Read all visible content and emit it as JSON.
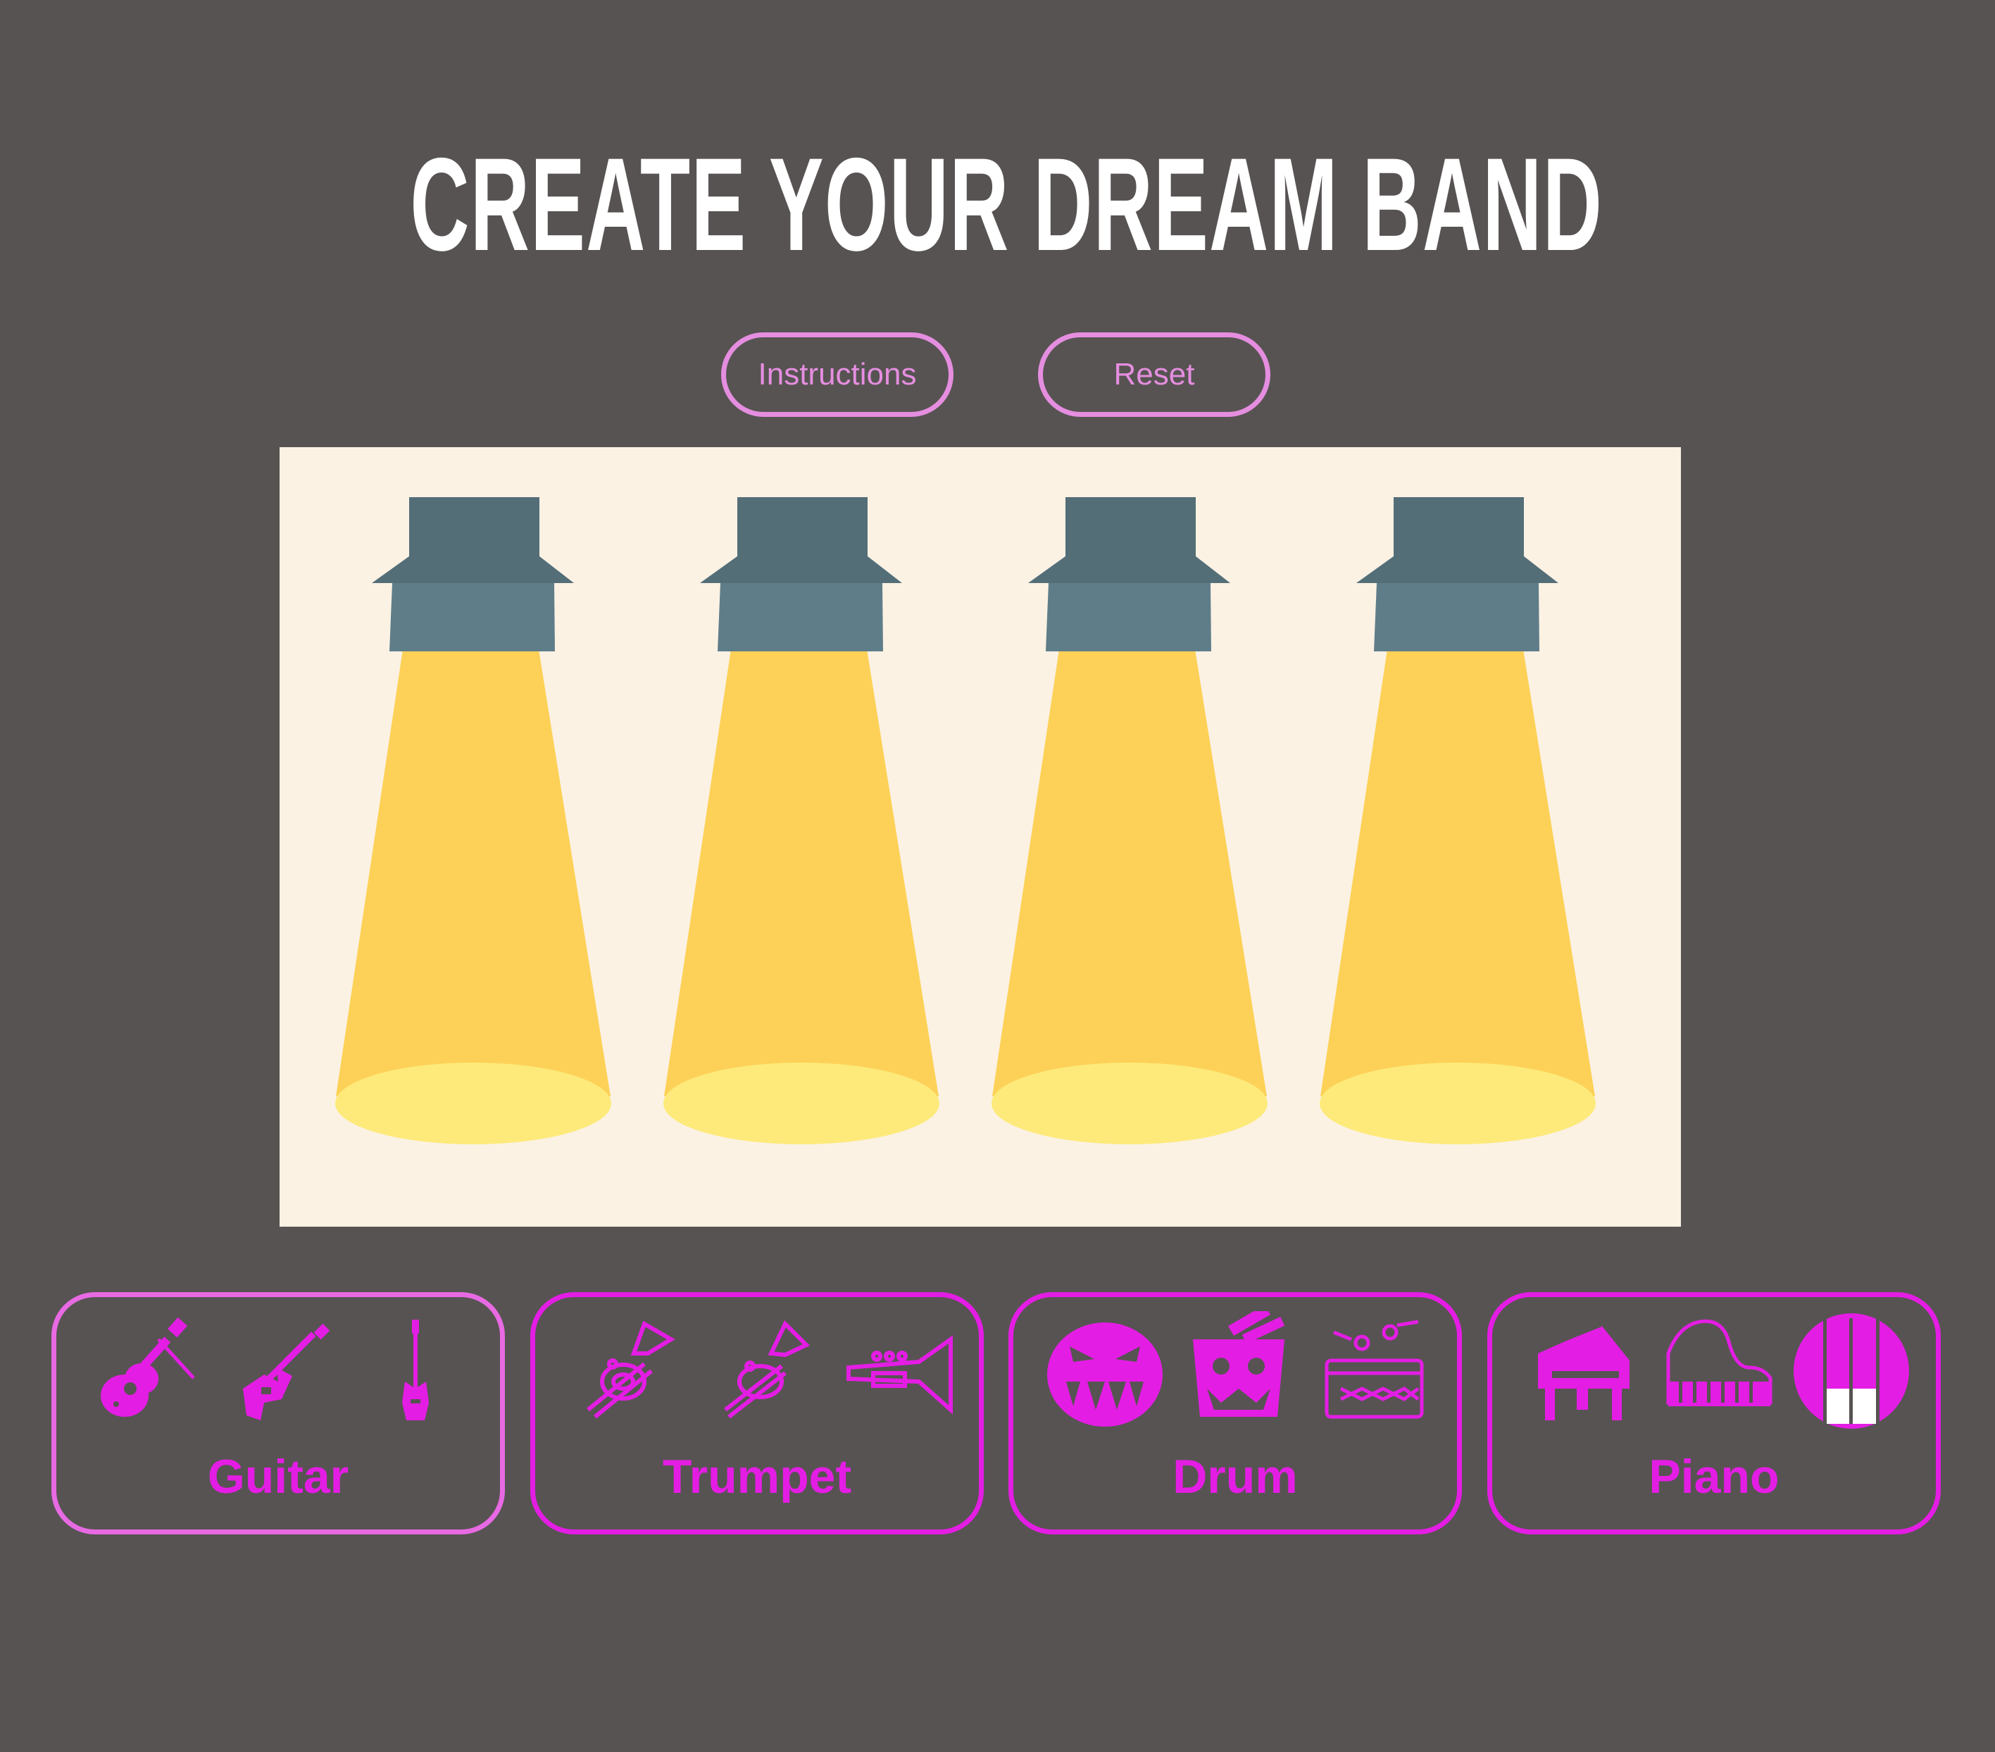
{
  "title": "CREATE YOUR DREAM BAND",
  "buttons": {
    "instructions": "Instructions",
    "reset": "Reset"
  },
  "stage": {
    "spotlight_count": 4,
    "colors": {
      "background": "#fbf2e4",
      "lamp": "#546e78",
      "lamp_lower": "#5f7d89",
      "beam": "#fdd157",
      "spot": "#fdea7b"
    }
  },
  "instruments": [
    {
      "label": "Guitar",
      "icons": [
        "acoustic-guitar-icon",
        "electric-guitar-icon",
        "bass-guitar-icon"
      ],
      "selected": true
    },
    {
      "label": "Trumpet",
      "icons": [
        "tuba-icon",
        "cornet-icon",
        "trumpet-icon"
      ],
      "selected": false
    },
    {
      "label": "Drum",
      "icons": [
        "angry-drum-icon",
        "drum-face-icon",
        "snare-drum-icon"
      ],
      "selected": false
    },
    {
      "label": "Piano",
      "icons": [
        "grand-piano-icon",
        "piano-outline-icon",
        "piano-keys-icon"
      ],
      "selected": false
    }
  ],
  "colors": {
    "page_background": "#575352",
    "title": "#ffffff",
    "button_outline": "#e58ee0",
    "accent": "#e41de4",
    "selected_outline": "#e86ae3"
  }
}
